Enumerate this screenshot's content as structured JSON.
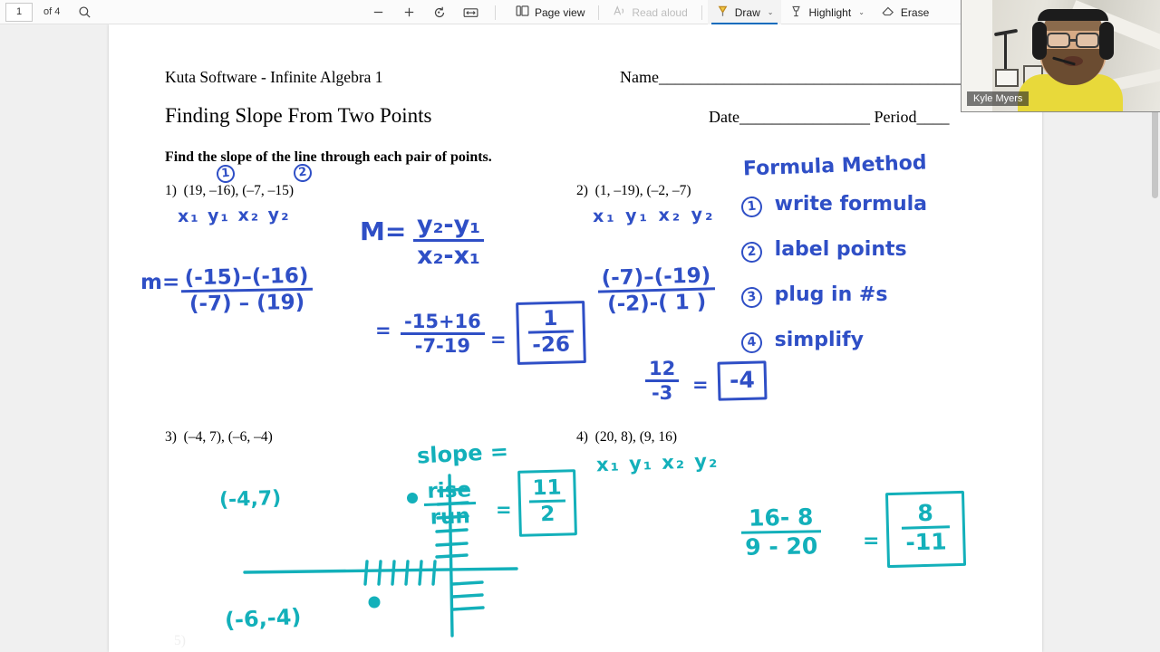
{
  "toolbar": {
    "page_current": "1",
    "page_total_label": "of 4",
    "search_icon": "search-icon",
    "zoom_out_icon": "minus-icon",
    "zoom_in_icon": "plus-icon",
    "rotate_icon": "rotate-icon",
    "fit_icon": "fit-to-width-icon",
    "page_view_label": "Page view",
    "page_view_icon": "page-view-icon",
    "read_aloud_label": "Read aloud",
    "read_aloud_icon": "read-aloud-icon",
    "draw_label": "Draw",
    "draw_icon": "pen-icon",
    "highlight_label": "Highlight",
    "highlight_icon": "highlighter-icon",
    "erase_label": "Erase",
    "erase_icon": "eraser-icon",
    "caret": "⌄",
    "accent_color": "#0f6cbd"
  },
  "document": {
    "publisher_line": "Kuta Software - Infinite Algebra 1",
    "title": "Finding Slope From Two Points",
    "instructions": "Find the slope of the line through each pair of points.",
    "name_field": "Name_______________________________________",
    "date_period_field": "Date________________  Period____",
    "problems": [
      {
        "number": "1)",
        "points": "(19, –16), (–7, –15)"
      },
      {
        "number": "2)",
        "points": "(1, –19), (–2, –7)"
      },
      {
        "number": "3)",
        "points": "(–4, 7), (–6, –4)"
      },
      {
        "number": "4)",
        "points": "(20, 8), (9, 16)"
      },
      {
        "number": "5)",
        "points": ""
      }
    ]
  },
  "annotations": {
    "blue_color": "#2f4fc6",
    "teal_color": "#13b0ba",
    "circle_1": "1",
    "circle_2": "2",
    "p1_labels": "x₁  y₁   x₂  y₂",
    "p1_m_equals": "M=",
    "p1_formula_num": "y₂-y₁",
    "p1_formula_den": "x₂-x₁",
    "p1_sub_lead": "m=",
    "p1_sub_num": "(-15)–(-16)",
    "p1_sub_den": "(-7) – (19)",
    "p1_eq1": "=",
    "p1_simp_num": "-15+16",
    "p1_simp_den": "-7-19",
    "p1_eq2": "=",
    "p1_answer_num": "1",
    "p1_answer_den": "-26",
    "p2_labels": "x₁ y₁   x₂  y₂",
    "p2_sub_num": "(-7)–(-19)",
    "p2_sub_den": "(-2)-( 1 )",
    "p2_simp_num": "12",
    "p2_simp_den": "-3",
    "p2_eq": "=",
    "p2_answer": "-4",
    "method_title": "Formula Method",
    "method_steps": [
      {
        "num": "1",
        "text": "write formula"
      },
      {
        "num": "2",
        "text": "label points"
      },
      {
        "num": "3",
        "text": "plug in #s"
      },
      {
        "num": "4",
        "text": "simplify"
      }
    ],
    "p3_point_a": "(-4,7)",
    "p3_point_b": "(-6,-4)",
    "p3_slope_label": "slope =",
    "p3_rise": "rise",
    "p3_run": "run",
    "p3_eq": "=",
    "p3_answer_num": "11",
    "p3_answer_den": "2",
    "p4_labels": "x₁ y₁  x₂ y₂",
    "p4_num": "16- 8",
    "p4_den": "9 - 20",
    "p4_eq": "=",
    "p4_answer_num": "8",
    "p4_answer_den": "-11"
  },
  "webcam": {
    "participant_name": "Kyle Myers"
  }
}
